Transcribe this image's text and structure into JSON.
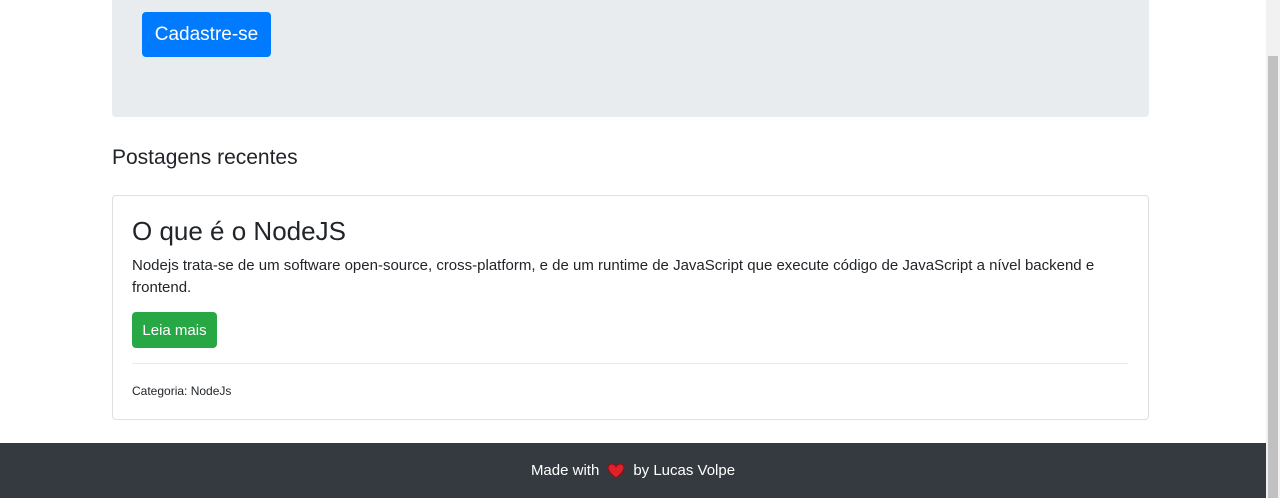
{
  "jumbotron": {
    "register_button": "Cadastre-se"
  },
  "posts_section": {
    "title": "Postagens recentes",
    "posts": [
      {
        "title": "O que é o NodeJS",
        "description": "Nodejs trata-se de um software open-source, cross-platform, e de um runtime de JavaScript que execute código de JavaScript a nível backend e frontend.",
        "read_more": "Leia mais",
        "category_text": "Categoria: NodeJs"
      }
    ]
  },
  "footer": {
    "made_with": "Made with",
    "by": "by Lucas Volpe",
    "heart_icon": "heart-icon"
  },
  "colors": {
    "primary": "#007bff",
    "success": "#28a745",
    "jumbotron_bg": "#e9ecef",
    "footer_bg": "#343a40",
    "heart": "#e0202a"
  }
}
